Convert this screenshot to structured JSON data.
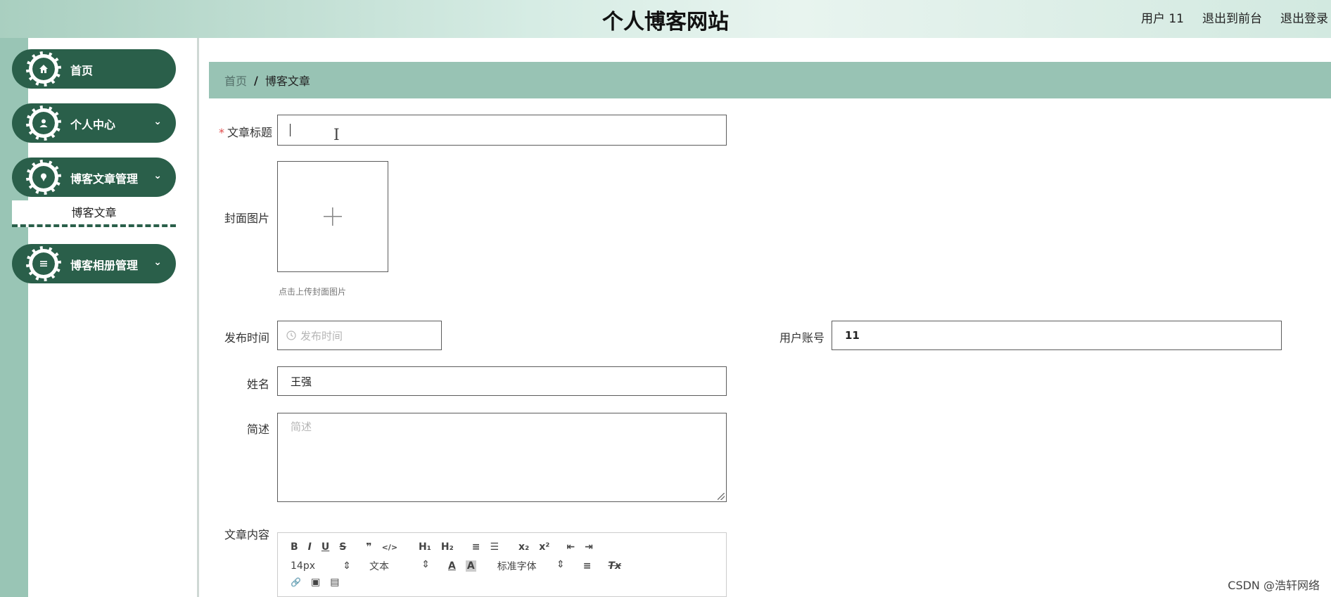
{
  "header": {
    "site_title": "个人博客网站",
    "user_label": "用户 11",
    "frontend_link": "退出到前台",
    "logout_link": "退出登录"
  },
  "sidebar": {
    "items": [
      {
        "label": "首页",
        "icon": "home-icon"
      },
      {
        "label": "个人中心",
        "icon": "user-icon"
      },
      {
        "label": "博客文章管理",
        "icon": "pin-icon"
      },
      {
        "label": "博客相册管理",
        "icon": "menu-icon"
      }
    ],
    "sub_item": "博客文章"
  },
  "breadcrumb": {
    "home": "首页",
    "separator": "/",
    "current": "博客文章"
  },
  "form": {
    "title_label": "文章标题",
    "required_mark": "*",
    "title_value": "",
    "cover_label": "封面图片",
    "cover_hint": "点击上传封面图片",
    "publish_label": "发布时间",
    "publish_placeholder": "发布时间",
    "account_label": "用户账号",
    "account_value": "11",
    "name_label": "姓名",
    "name_value": "王强",
    "summary_label": "简述",
    "summary_placeholder": "简述",
    "content_label": "文章内容"
  },
  "editor": {
    "row1": [
      "B",
      "I",
      "U",
      "S",
      "❞",
      "</>",
      "H₁",
      "H₂",
      "≡",
      "☰",
      "x₂",
      "x²",
      "⇤",
      "⇥"
    ],
    "font_size": "14px",
    "text_style": "文本",
    "font_family": "标准字体",
    "align": "≡",
    "clear": "Tx",
    "row3": [
      "🔗",
      "▣",
      "▤"
    ]
  },
  "watermark": "CSDN @浩轩网络",
  "colors": {
    "primary": "#2a5f4a",
    "breadcrumb_bg": "#98c3b4",
    "left_strip": "#99c5b5"
  }
}
